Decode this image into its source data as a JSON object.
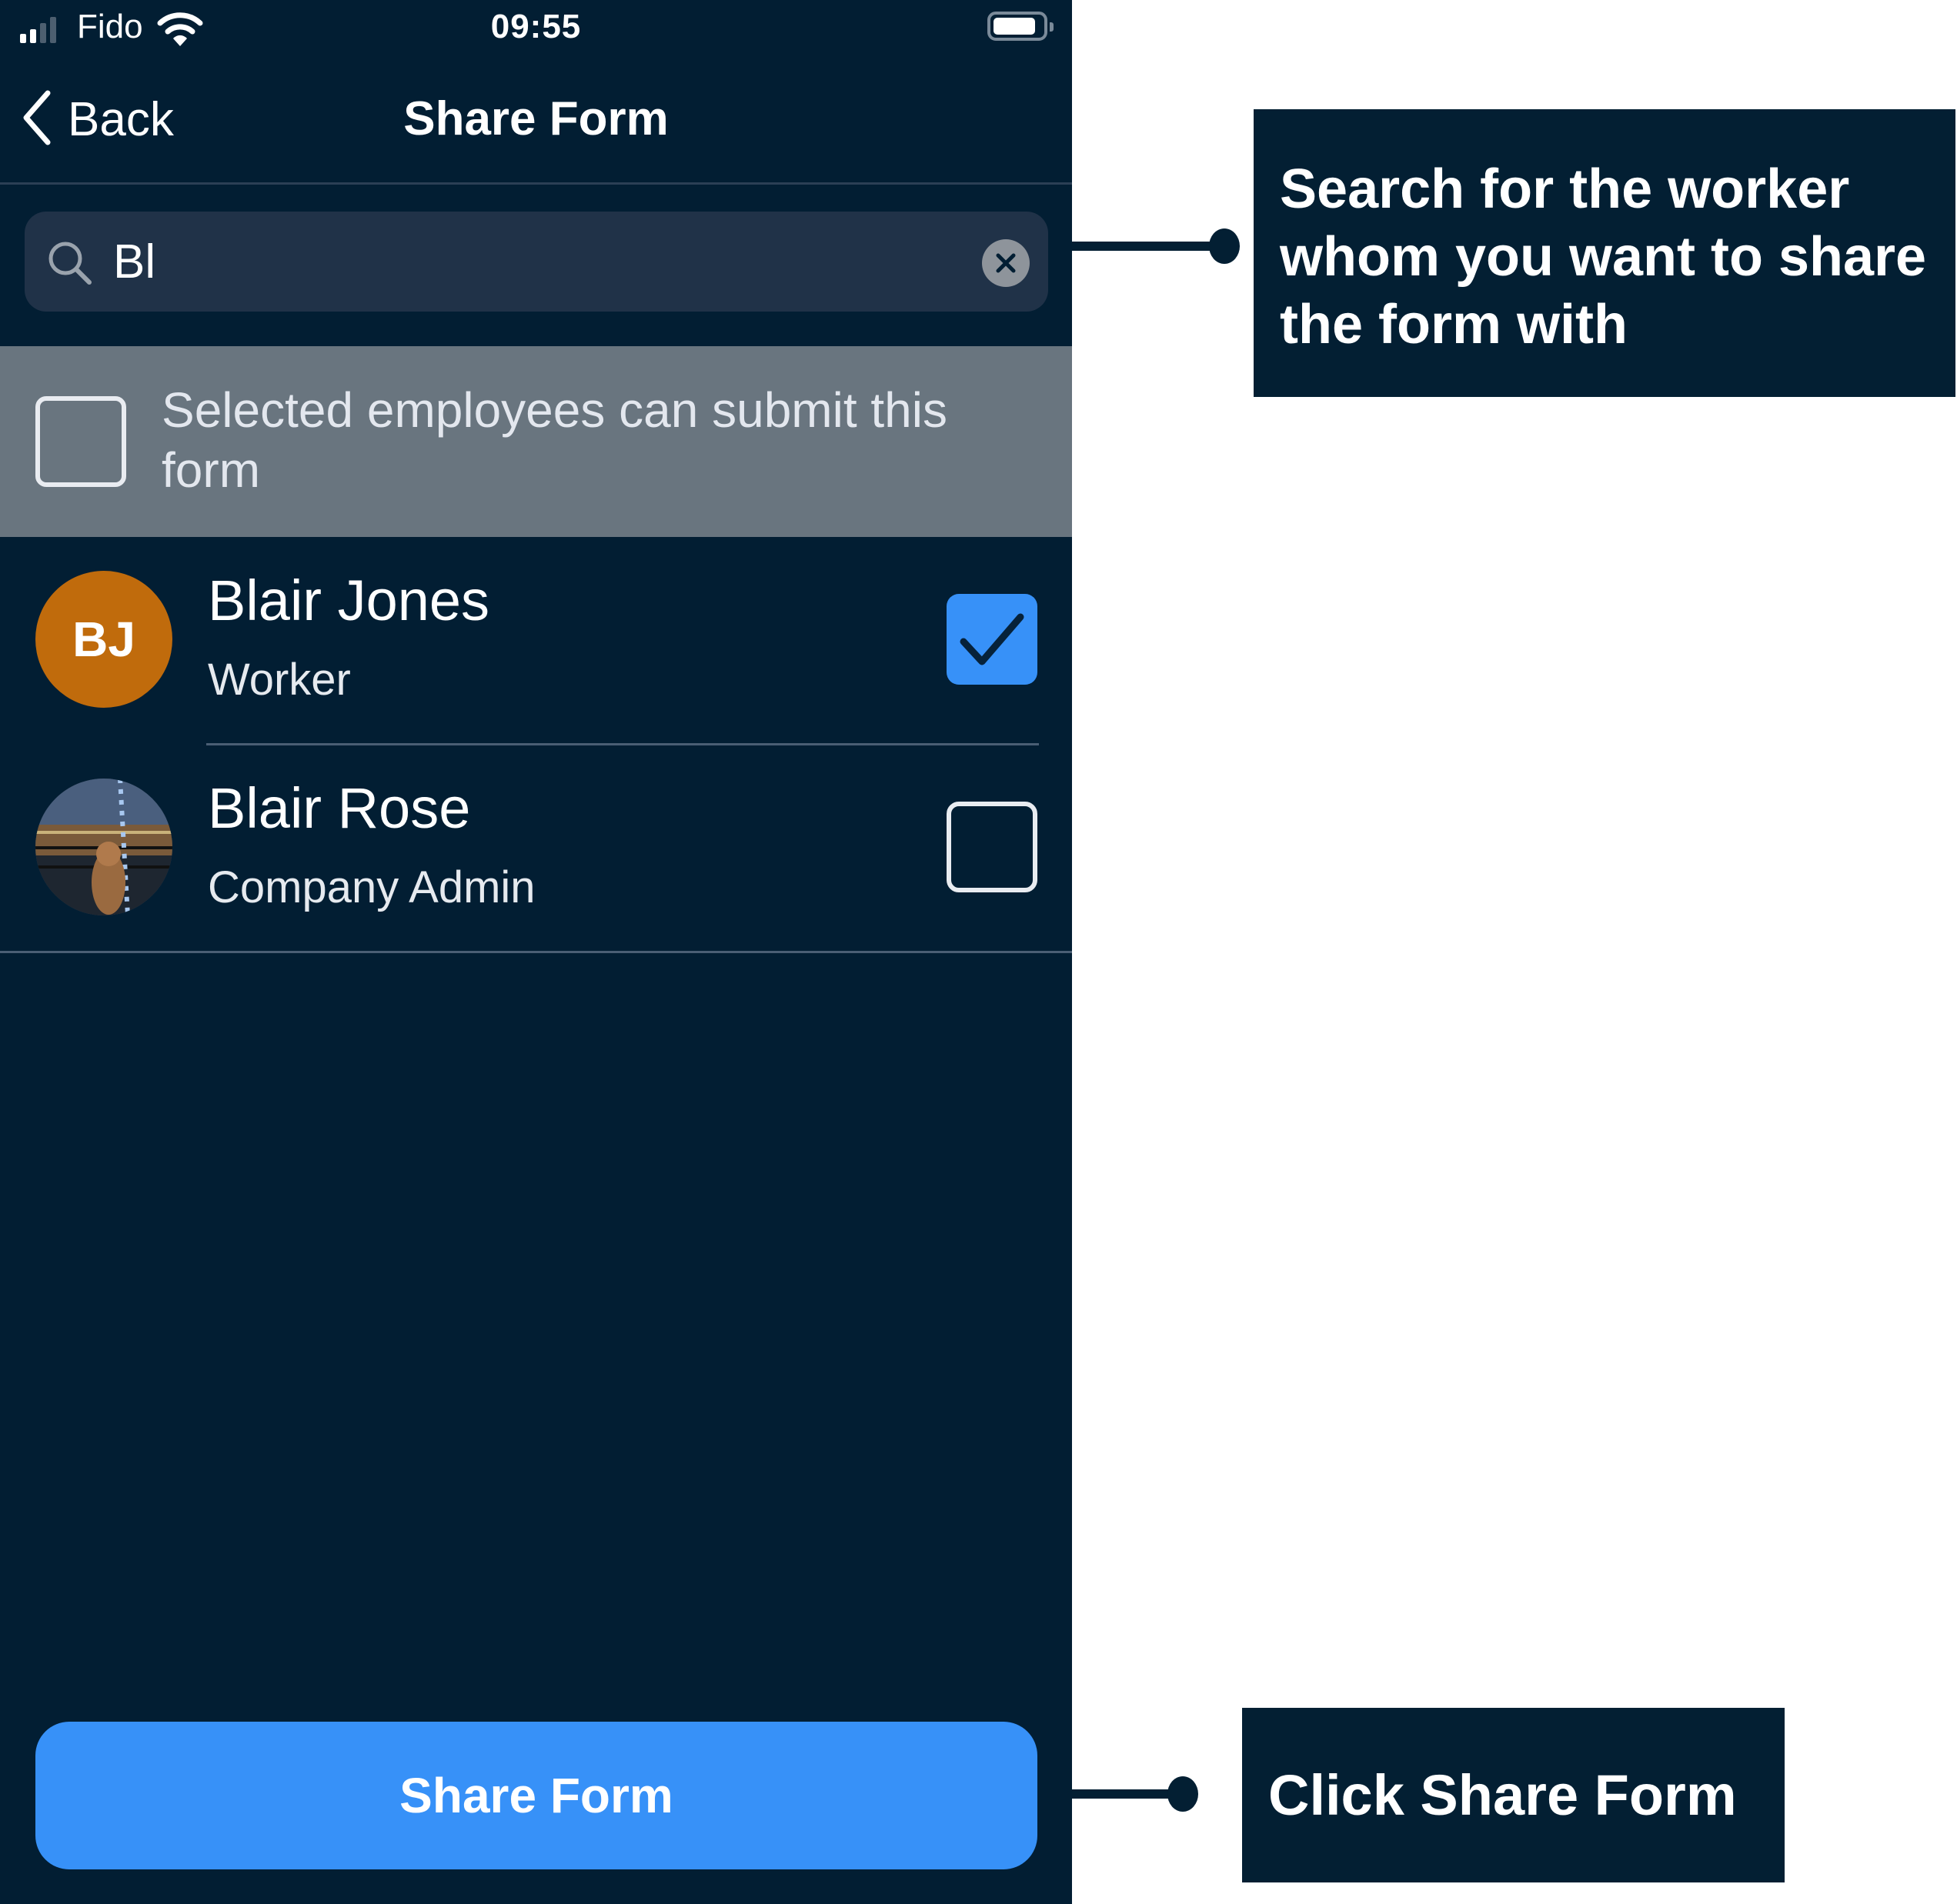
{
  "status_bar": {
    "carrier": "Fido",
    "time": "09:55",
    "signal_bars_active": 2,
    "signal_bars_total": 4,
    "icons": [
      "signal-icon",
      "wifi-icon",
      "battery-icon"
    ]
  },
  "nav": {
    "back_label": "Back",
    "title": "Share Form"
  },
  "search": {
    "value": "Bl",
    "placeholder": "",
    "icons": [
      "search-icon",
      "clear-icon"
    ]
  },
  "submit_option": {
    "label": "Selected employees can submit this form",
    "checked": false
  },
  "people": [
    {
      "name": "Blair Jones",
      "role": "Worker",
      "initials": "BJ",
      "avatar_type": "initials",
      "checked": true
    },
    {
      "name": "Blair Rose",
      "role": "Company Admin",
      "avatar_type": "photo",
      "checked": false
    }
  ],
  "share_button_label": "Share Form",
  "callouts": [
    {
      "text": "Search for the worker whom you want to share the form with",
      "target": "search"
    },
    {
      "text": "Click Share Form",
      "target": "share-button"
    }
  ],
  "colors": {
    "background": "#021e33",
    "accent": "#3791f8",
    "avatar_orange": "#c06b0c",
    "submit_row": "#69757f",
    "search_field": "#203248",
    "callout": "#031f33"
  }
}
